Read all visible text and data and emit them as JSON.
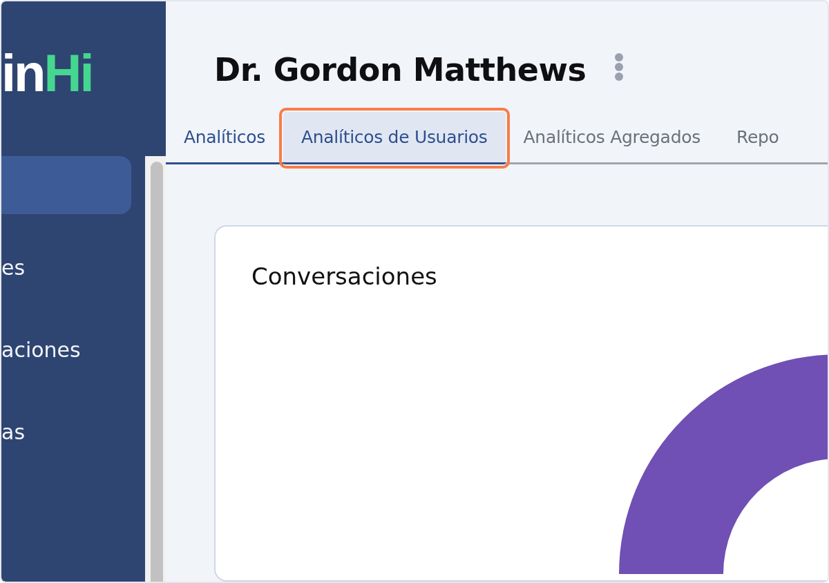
{
  "sidebar": {
    "logo": {
      "light_part": "in",
      "accent_part": "Hi"
    },
    "items": [
      {
        "selected": true
      },
      {
        "label": "es",
        "selected": false
      },
      {
        "label": "aciones",
        "selected": false
      },
      {
        "label": "as",
        "selected": false
      }
    ]
  },
  "header": {
    "title": "Dr. Gordon Matthews"
  },
  "tabs": [
    {
      "label": "Analíticos",
      "selected": false,
      "underlined": true,
      "highlight": false
    },
    {
      "label": "Analíticos de Usuarios",
      "selected": true,
      "underlined": true,
      "highlight": true
    },
    {
      "label": "Analíticos Agregados",
      "selected": false,
      "underlined": false,
      "highlight": false
    },
    {
      "label": "Repo",
      "selected": false,
      "underlined": false,
      "highlight": false
    }
  ],
  "card": {
    "title": "Conversaciones"
  }
}
